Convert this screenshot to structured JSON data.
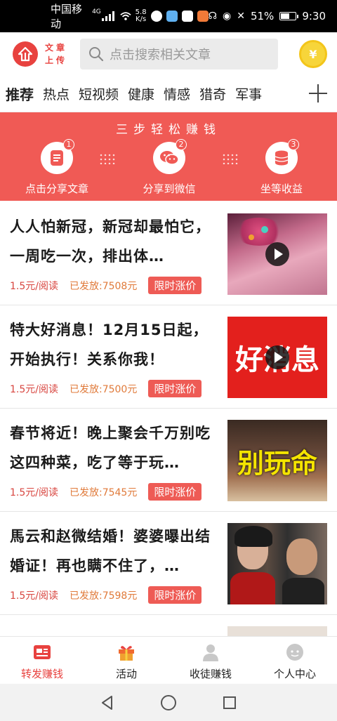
{
  "status": {
    "carrier": "中国移动",
    "net_speed_value": "5.8",
    "net_speed_unit": "K/s",
    "network_type": "4G",
    "battery": "51%",
    "battery_level": 0.51,
    "time": "9:30"
  },
  "header": {
    "logo_text": "文章上传",
    "search_placeholder": "点击搜索相关文章",
    "coin_symbol": "¥"
  },
  "tabs": [
    "推荐",
    "热点",
    "短视频",
    "健康",
    "情感",
    "猎奇",
    "军事"
  ],
  "banner": {
    "title": "三步轻松赚钱",
    "steps": [
      {
        "num": "1",
        "label": "点击分享文章",
        "icon": "document-icon"
      },
      {
        "num": "2",
        "label": "分享到微信",
        "icon": "wechat-icon"
      },
      {
        "num": "3",
        "label": "坐等收益",
        "icon": "coins-icon"
      }
    ]
  },
  "articles": [
    {
      "title": "人人怕新冠，新冠却最怕它，一周吃一次，排出体…",
      "price": "1.5元/阅读",
      "issued": "已发放:7508元",
      "tag": "限时涨价",
      "thumb_text": ""
    },
    {
      "title": "特大好消息！12月15日起，开始执行！关系你我！",
      "price": "1.5元/阅读",
      "issued": "已发放:7500元",
      "tag": "限时涨价",
      "thumb_text": "好消息"
    },
    {
      "title": "春节将近！晚上聚会千万别吃这四种菜，吃了等于玩…",
      "price": "1.5元/阅读",
      "issued": "已发放:7545元",
      "tag": "限时涨价",
      "thumb_text": "别玩命"
    },
    {
      "title": "馬云和赵微结婚！婆婆曝出结婚证！再也瞒不住了，…",
      "price": "1.5元/阅读",
      "issued": "已发放:7598元",
      "tag": "限时涨价",
      "thumb_text": ""
    }
  ],
  "bottom_nav": [
    {
      "label": "转发赚钱",
      "icon": "article-icon",
      "active": true
    },
    {
      "label": "活动",
      "icon": "gift-icon",
      "active": false
    },
    {
      "label": "收徒赚钱",
      "icon": "person-icon",
      "active": false
    },
    {
      "label": "个人中心",
      "icon": "profile-icon",
      "active": false
    }
  ],
  "colors": {
    "accent": "#e8423f",
    "banner": "#f05a55",
    "coin": "#f7d53a"
  }
}
